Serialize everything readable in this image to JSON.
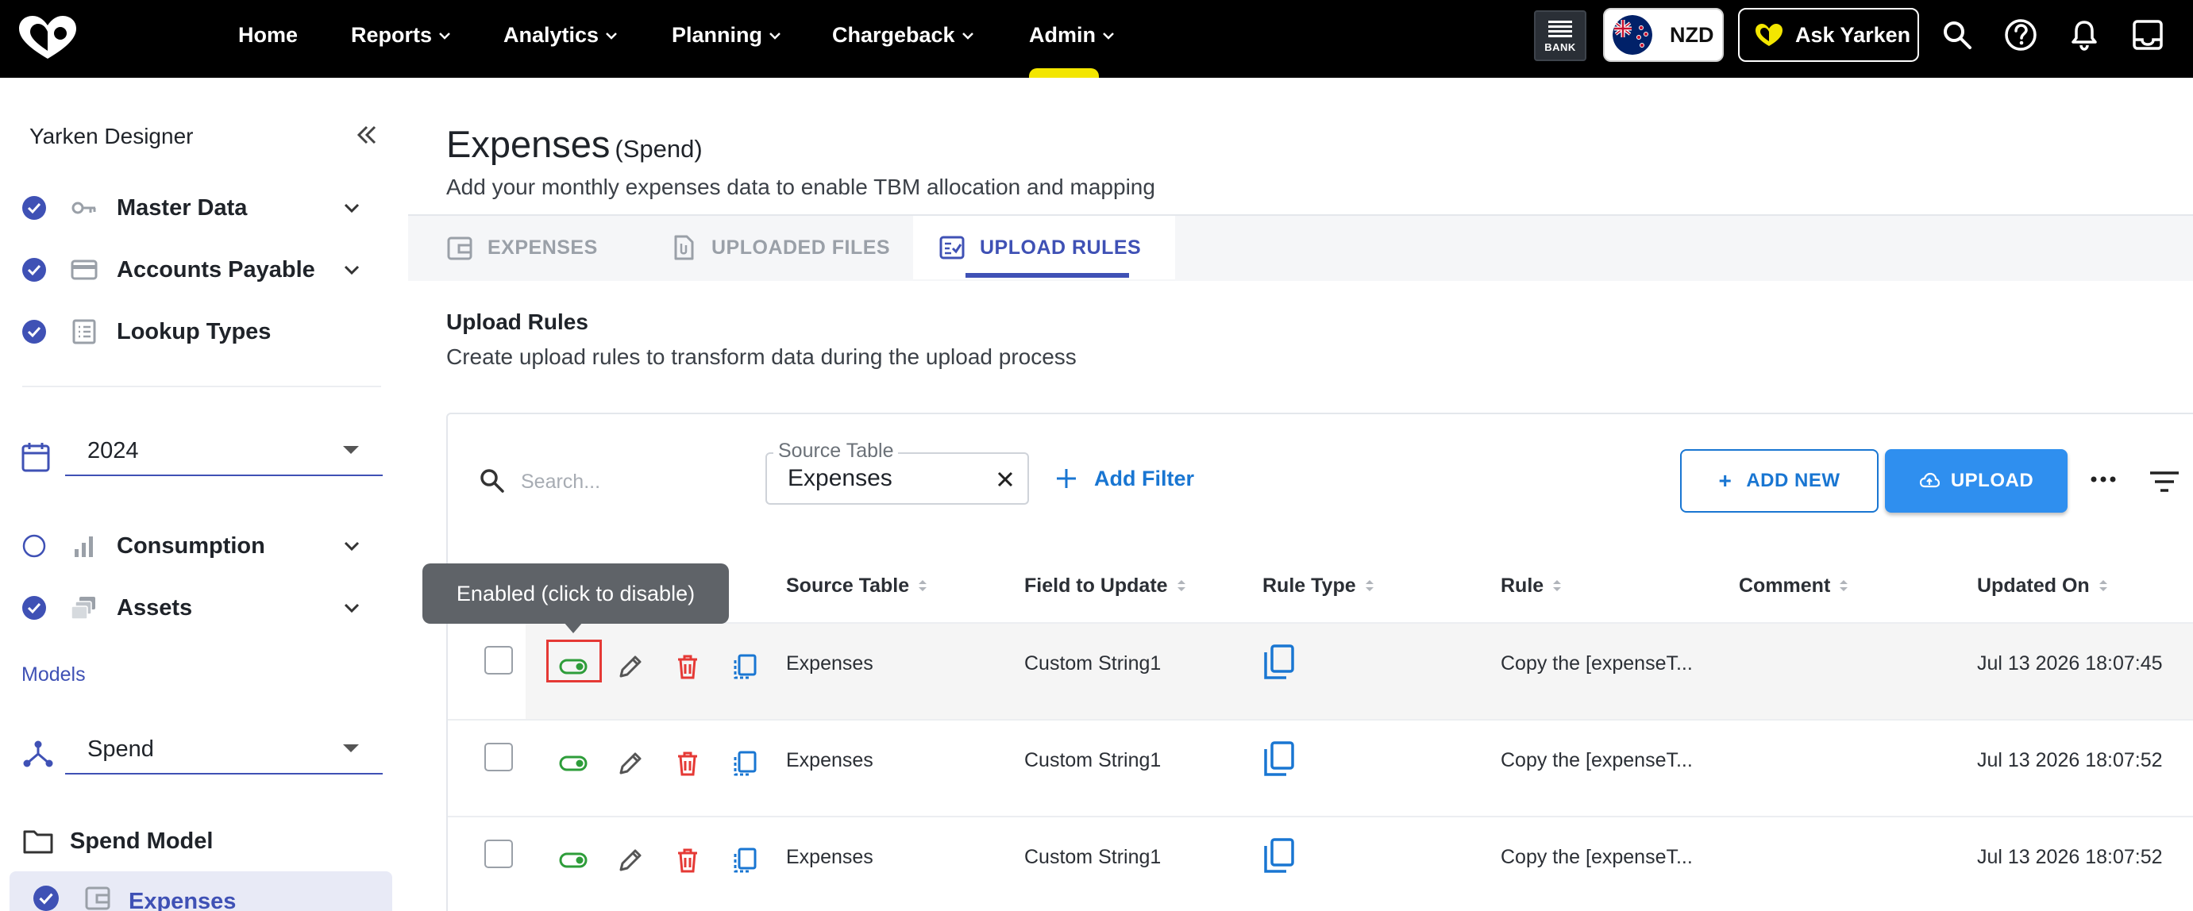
{
  "nav": {
    "items": [
      "Home",
      "Reports",
      "Analytics",
      "Planning",
      "Chargeback",
      "Admin"
    ],
    "bank_label": "BANK",
    "currency": "NZD",
    "ask_label": "Ask Yarken"
  },
  "sidebar": {
    "title": "Yarken Designer",
    "items": [
      {
        "label": "Master Data",
        "checked": true
      },
      {
        "label": "Accounts Payable",
        "checked": true
      },
      {
        "label": "Lookup Types",
        "checked": true
      }
    ],
    "year": "2024",
    "items2": [
      {
        "label": "Consumption",
        "checked": false
      },
      {
        "label": "Assets",
        "checked": true
      }
    ],
    "models_label": "Models",
    "model": "Spend",
    "model_group": "Spend Model",
    "selected_item": "Expenses"
  },
  "header": {
    "title": "Expenses",
    "subtitle": "(Spend)",
    "description": "Add your monthly expenses data to enable TBM allocation and mapping"
  },
  "tabs": [
    {
      "label": "EXPENSES",
      "active": false
    },
    {
      "label": "UPLOADED FILES",
      "active": false
    },
    {
      "label": "UPLOAD RULES",
      "active": true
    }
  ],
  "section": {
    "title": "Upload Rules",
    "description": "Create upload rules to transform data during the upload process"
  },
  "toolbar": {
    "search_placeholder": "Search...",
    "filter_label": "Source Table",
    "filter_value": "Expenses",
    "add_filter": "Add Filter",
    "add_new": "ADD NEW",
    "upload": "UPLOAD"
  },
  "table": {
    "columns": [
      "Source Table",
      "Field to Update",
      "Rule Type",
      "Rule",
      "Comment",
      "Updated On"
    ],
    "rows": [
      {
        "source": "Expenses",
        "field": "Custom String1",
        "rule": "Copy the [expenseT...",
        "comment": "",
        "updated": "Jul 13 2026 18:07:45"
      },
      {
        "source": "Expenses",
        "field": "Custom String1",
        "rule": "Copy the [expenseT...",
        "comment": "",
        "updated": "Jul 13 2026 18:07:52"
      },
      {
        "source": "Expenses",
        "field": "Custom String1",
        "rule": "Copy the [expenseT...",
        "comment": "",
        "updated": "Jul 13 2026 18:07:52"
      }
    ]
  },
  "tooltip": "Enabled (click to disable)",
  "colors": {
    "accent": "#3f51b5",
    "primary_blue": "#1976d2",
    "upload_blue": "#2f8fef",
    "toggle_green": "#2e9d3a",
    "delete_red": "#e53935",
    "nav_bg": "#000000",
    "admin_indicator": "#f3e600"
  }
}
